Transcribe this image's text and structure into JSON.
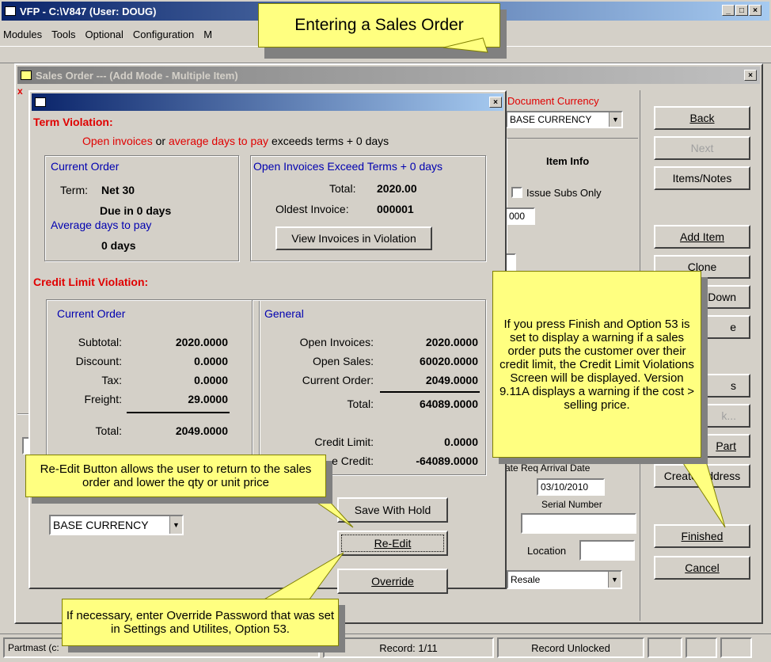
{
  "app": {
    "title": "VFP - C:\\V847  (User: DOUG)",
    "menu": [
      "Modules",
      "Tools",
      "Optional",
      "Configuration",
      "M"
    ]
  },
  "banner": {
    "text": "Entering a Sales Order"
  },
  "sales_order": {
    "title": "Sales Order --- (Add Mode - Multiple Item)",
    "doc_currency_label": "Document Currency",
    "doc_currency_value": "BASE CURRENCY",
    "item_info_label": "Item Info",
    "issue_subs_label": "Issue Subs Only",
    "partial_field": "000",
    "req_arrival_label": "ate Req Arrival Date",
    "req_arrival_value": "03/10/2010",
    "serial_label": "Serial Number",
    "location_label": "Location",
    "resale_value": "Resale"
  },
  "side_buttons": {
    "back": "Back",
    "next": "Next",
    "items_notes": "Items/Notes",
    "add_item": "Add Item",
    "clone": "Clone",
    "down": "Down",
    "e": "e",
    "s": "s",
    "k": "k...",
    "part": "Part",
    "create_address": "Create Address",
    "finished": "Finished",
    "cancel": "Cancel"
  },
  "status_bar": {
    "left": "Partmast (c:",
    "record": "Record: 1/11",
    "lock": "Record Unlocked"
  },
  "violation": {
    "term_heading": "Term Violation:",
    "term_line_red1": "Open invoices",
    "term_line_or": "or",
    "term_line_red2": "average days to pay",
    "term_line_rest": "exceeds terms + 0 days",
    "current_order_label": "Current Order",
    "term_label": "Term:",
    "term_value": "Net 30",
    "due_text": "Due in 0 days",
    "avg_days_label": "Average days to pay",
    "avg_days_value": "0 days",
    "open_inv_heading": "Open Invoices Exceed Terms + 0 days",
    "total_label": "Total:",
    "total_value": "2020.00",
    "oldest_label": "Oldest Invoice:",
    "oldest_value": "000001",
    "view_invoices_button": "View Invoices in Violation",
    "credit_heading": "Credit Limit Violation:",
    "co_label": "Current Order",
    "subtotal_label": "Subtotal:",
    "subtotal_value": "2020.0000",
    "discount_label": "Discount:",
    "discount_value": "0.0000",
    "tax_label": "Tax:",
    "tax_value": "0.0000",
    "freight_label": "Freight:",
    "freight_value": "29.0000",
    "co_total_label": "Total:",
    "co_total_value": "2049.0000",
    "general_label": "General",
    "open_invoices_label": "Open Invoices:",
    "open_invoices_value": "2020.0000",
    "open_sales_label": "Open Sales:",
    "open_sales_value": "60020.0000",
    "current_order_row_label": "Current Order:",
    "current_order_row_value": "2049.0000",
    "gen_total_label": "Total:",
    "gen_total_value": "64089.0000",
    "credit_limit_label": "Credit Limit:",
    "credit_limit_value": "0.0000",
    "avail_credit_label": "e Credit:",
    "avail_credit_value": "-64089.0000",
    "currency_value": "BASE CURRENCY",
    "save_with_hold_button": "Save With Hold",
    "re_edit_button": "Re-Edit",
    "override_button": "Override"
  },
  "callouts": {
    "finish_note": "If you press Finish and Option 53 is  set to display a warning if a sales order puts the customer over their credit limit, the Credit Limit Violations Screen will be displayed.  Version 9.11A displays a warning if the cost > selling price.",
    "reedit_note": "Re-Edit Button allows the user to return to the sales order and lower the qty or unit price",
    "override_note": "If necessary, enter Override Password that was set in Settings and Utilites, Option 53."
  }
}
